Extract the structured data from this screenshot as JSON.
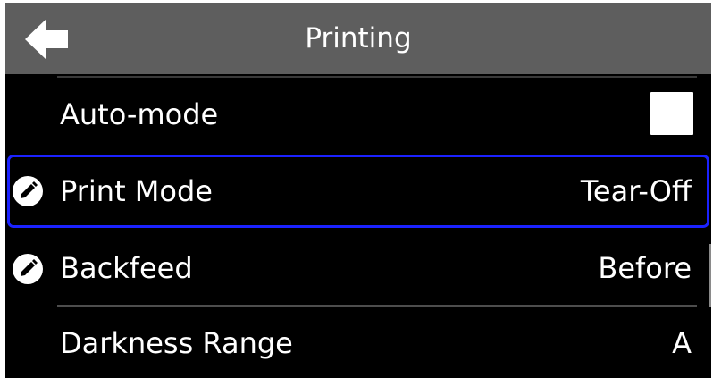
{
  "header": {
    "title": "Printing",
    "back_icon": "arrow-left-icon"
  },
  "settings": {
    "auto_mode": {
      "label": "Auto-mode",
      "checked": false
    },
    "print_mode": {
      "label": "Print Mode",
      "value": "Tear-Off",
      "icon": "pencil-icon",
      "selected": true
    },
    "backfeed": {
      "label": "Backfeed",
      "value": "Before",
      "icon": "pencil-icon"
    },
    "darkness_range": {
      "label": "Darkness Range",
      "value": "A"
    }
  },
  "colors": {
    "header_bg": "#5e5e5e",
    "screen_bg": "#000000",
    "focus_border": "#1b22ff",
    "text": "#ffffff"
  }
}
